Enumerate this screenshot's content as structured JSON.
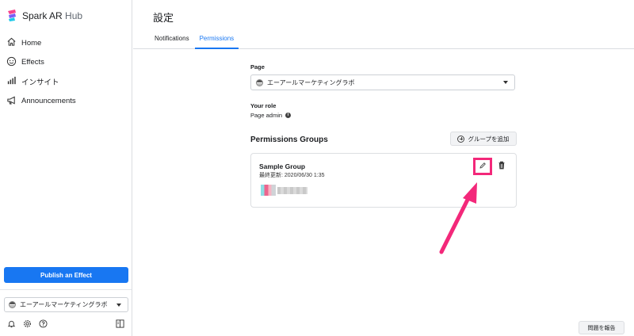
{
  "brand": {
    "name": "Spark AR",
    "suffix": "Hub"
  },
  "sidebar": {
    "items": [
      {
        "label": "Home",
        "icon": "home-icon"
      },
      {
        "label": "Effects",
        "icon": "smiley-icon"
      },
      {
        "label": "インサイト",
        "icon": "bar-chart-icon"
      },
      {
        "label": "Announcements",
        "icon": "megaphone-icon"
      }
    ],
    "publish_label": "Publish an Effect",
    "page_selector": "エーアールマーケティングラボ",
    "footer_icons": [
      "bell-icon",
      "gear-icon",
      "help-icon",
      "panel-toggle-icon"
    ]
  },
  "header": {
    "title": "設定",
    "tabs": [
      {
        "label": "Notifications",
        "active": false
      },
      {
        "label": "Permissions",
        "active": true
      }
    ]
  },
  "main": {
    "page_label": "Page",
    "page_value": "エーアールマーケティングラボ",
    "role_label": "Your role",
    "role_value": "Page admin",
    "groups_title": "Permissions Groups",
    "add_group_label": "グループを追加",
    "group": {
      "name": "Sample Group",
      "updated": "最終更新: 2020/06/30 1:35"
    }
  },
  "report_label": "問題を報告",
  "colors": {
    "accent": "#1877f2",
    "highlight": "#f3287a"
  }
}
